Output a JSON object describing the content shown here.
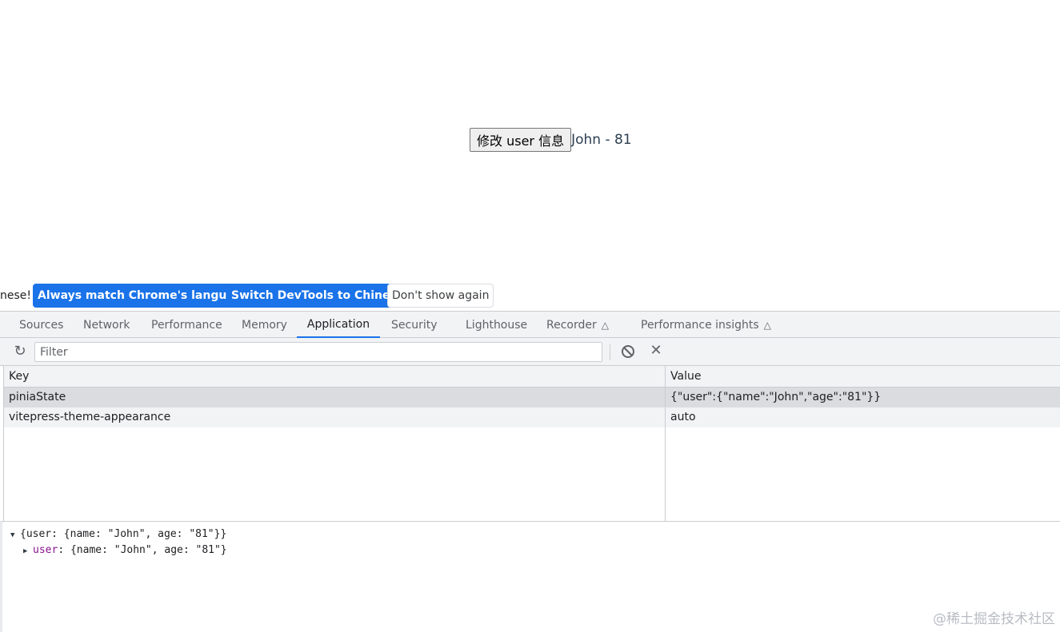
{
  "page": {
    "button_label": "修改 user 信息",
    "user_text": "John - 81"
  },
  "infobar": {
    "message": "nese!",
    "always_match_label": "Always match Chrome's language",
    "switch_label": "Switch DevTools to Chinese",
    "dont_show_label": "Don't show again"
  },
  "tabs": [
    {
      "label": "Sources"
    },
    {
      "label": "Network"
    },
    {
      "label": "Performance"
    },
    {
      "label": "Memory"
    },
    {
      "label": "Application",
      "active": true
    },
    {
      "label": "Security"
    },
    {
      "label": "Lighthouse"
    },
    {
      "label": "Recorder",
      "icon": "flask-icon"
    },
    {
      "label": "Performance insights",
      "icon": "flask-icon"
    }
  ],
  "toolbar": {
    "filter_placeholder": "Filter",
    "icons": [
      "refresh-icon",
      "clear-all-icon",
      "delete-icon"
    ]
  },
  "storage_table": {
    "columns": [
      "Key",
      "Value"
    ],
    "rows": [
      {
        "key": "piniaState",
        "value": "{\"user\":{\"name\":\"John\",\"age\":\"81\"}}",
        "selected": true
      },
      {
        "key": "vitepress-theme-appearance",
        "value": "auto"
      }
    ]
  },
  "preview": {
    "root_open": "{user: {name: \"John\", age: \"81\"}}",
    "child_key": "user",
    "child_value": ": {name: \"John\", age: \"81\"}"
  },
  "watermark": "@稀土掘金技术社区"
}
